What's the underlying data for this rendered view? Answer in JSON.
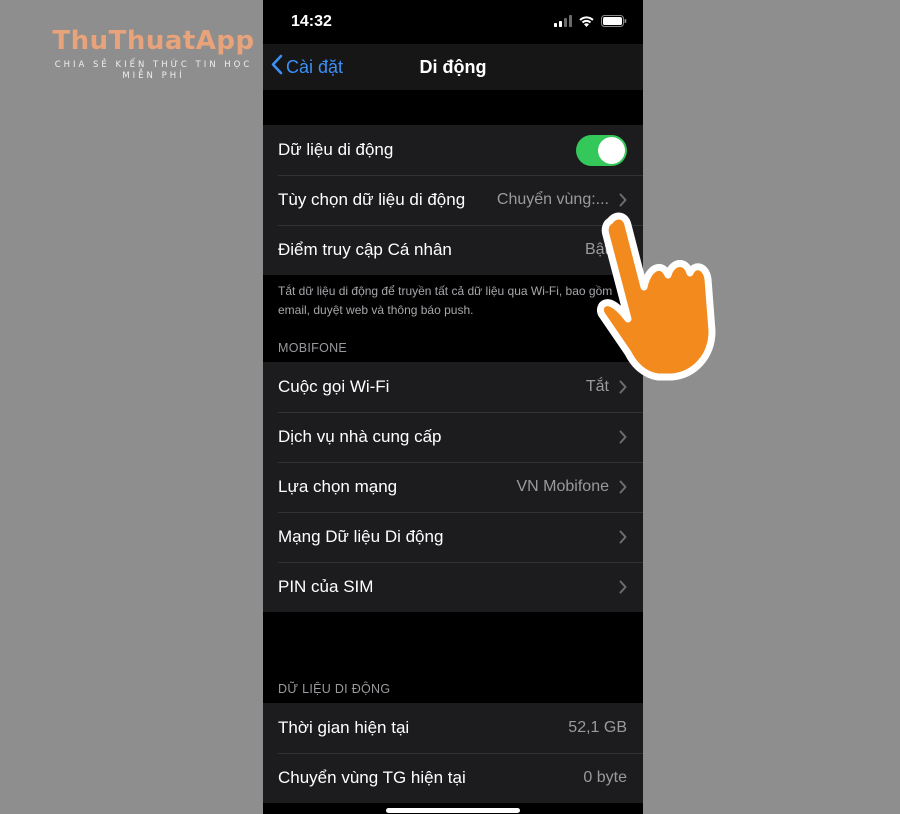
{
  "watermark": {
    "logo": "ThuThuatApp",
    "tagline_line1": "CHIA SẺ KIẾN THỨC TIN HỌC",
    "tagline_line2": "MIỄN PHÍ"
  },
  "status_bar": {
    "time": "14:32",
    "icons": [
      "cellular-signal-icon",
      "wifi-icon",
      "battery-icon"
    ]
  },
  "navbar": {
    "back_label": "Cài đặt",
    "title": "Di động"
  },
  "group1": [
    {
      "label": "Dữ liệu di động",
      "toggle_on": true
    },
    {
      "label": "Tùy chọn dữ liệu di động",
      "value": "Chuyển vùng:..."
    },
    {
      "label": "Điểm truy cập Cá nhân",
      "value": "Bật"
    }
  ],
  "footnote": "Tắt dữ liệu di động để truyền tất cả dữ liệu qua Wi-Fi, bao gồm email, duyệt web và thông báo push.",
  "section_mobifone": "MOBIFONE",
  "group2": [
    {
      "label": "Cuộc gọi Wi-Fi",
      "value": "Tắt"
    },
    {
      "label": "Dịch vụ nhà cung cấp",
      "value": ""
    },
    {
      "label": "Lựa chọn mạng",
      "value": "VN Mobifone"
    },
    {
      "label": "Mạng Dữ liệu Di động",
      "value": ""
    },
    {
      "label": "PIN của SIM",
      "value": ""
    }
  ],
  "section_data": "DỮ LIỆU DI ĐỘNG",
  "group3": [
    {
      "label": "Thời gian hiện tại",
      "value": "52,1 GB"
    },
    {
      "label": "Chuyển vùng TG hiện tại",
      "value": "0 byte"
    }
  ],
  "colors": {
    "toggle_on": "#34c759",
    "link_blue": "#3b8ff6",
    "hand_orange": "#f28a1e",
    "watermark_orange": "#e9a37a"
  }
}
